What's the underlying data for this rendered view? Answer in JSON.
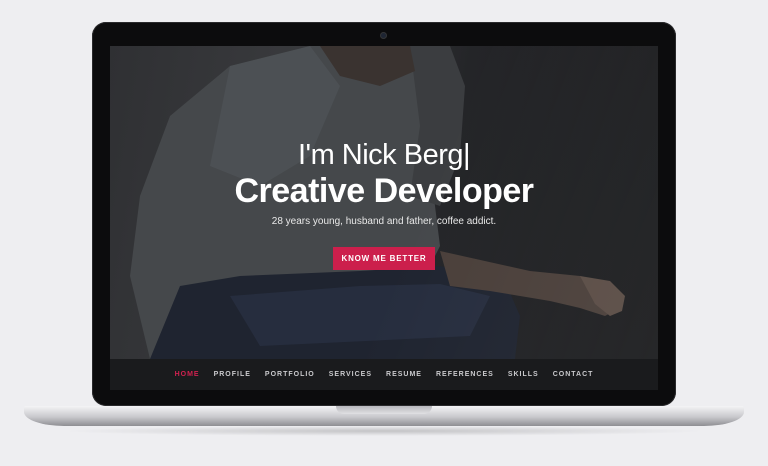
{
  "hero": {
    "intro": "I'm Nick Berg",
    "cursor": "|",
    "title": "Creative Developer",
    "subtitle": "28 years young, husband and father, coffee addict.",
    "cta_label": "KNOW ME BETTER"
  },
  "nav": {
    "items": [
      {
        "label": "HOME",
        "active": true
      },
      {
        "label": "PROFILE"
      },
      {
        "label": "PORTFOLIO"
      },
      {
        "label": "SERVICES"
      },
      {
        "label": "RESUME"
      },
      {
        "label": "REFERENCES"
      },
      {
        "label": "SKILLS"
      },
      {
        "label": "CONTACT"
      }
    ]
  },
  "colors": {
    "accent": "#cc1f4c",
    "nav_background": "#1a1b1d",
    "page_background": "#eeeef1"
  }
}
